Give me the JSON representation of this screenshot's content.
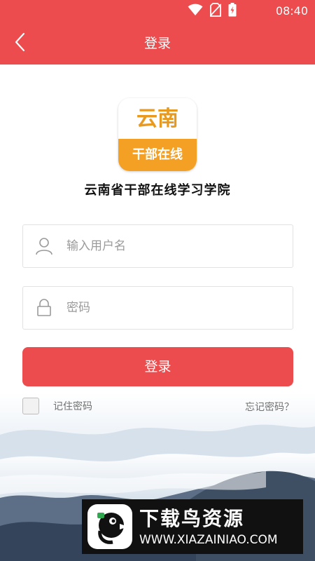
{
  "status_bar": {
    "time": "08:40"
  },
  "header": {
    "title": "登录",
    "back_icon": "chevron-left-icon"
  },
  "logo": {
    "icon_top_text": "云南",
    "icon_bottom_text": "干部在线",
    "org_name": "云南省干部在线学习学院"
  },
  "form": {
    "username": {
      "placeholder": "输入用户名",
      "value": "",
      "icon": "user-icon"
    },
    "password": {
      "placeholder": "密码",
      "value": "",
      "icon": "lock-icon"
    },
    "login_label": "登录",
    "remember_label": "记住密码",
    "remember_checked": false,
    "forgot_label": "忘记密码？"
  },
  "watermark": {
    "title": "下载鸟资源",
    "url": "WWW.XIAZAINIAO.COM"
  },
  "colors": {
    "brand_red": "#ec4c4e",
    "icon_orange": "#f3a024"
  }
}
